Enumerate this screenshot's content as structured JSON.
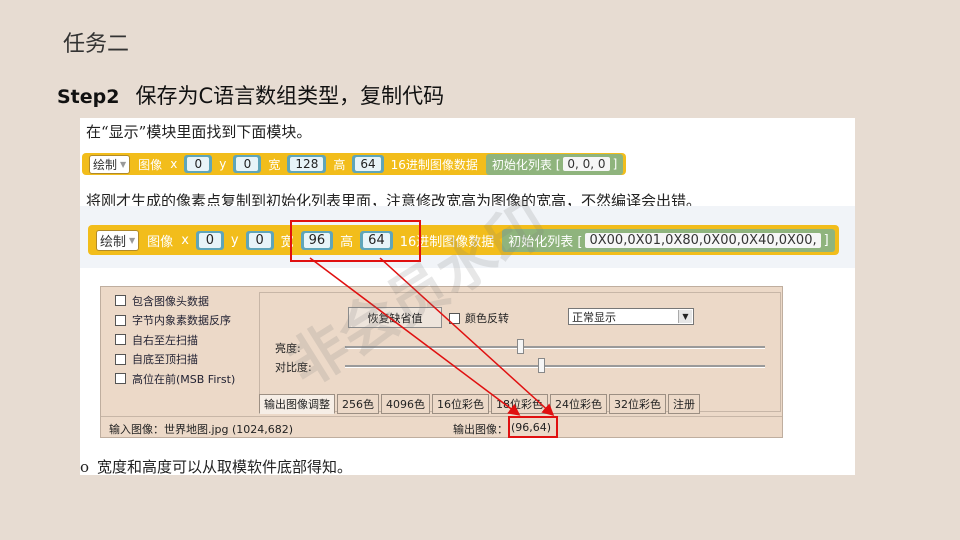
{
  "slide": {
    "title": "任务二",
    "step_num": "Step2",
    "step_text": "保存为C语言数组类型，复制代码"
  },
  "doc": {
    "line1": "在“显示”模块里面找到下面模块。",
    "line2": "将刚才生成的像素点复制到初始化列表里面，注意修改宽高为图像的宽高，不然编译会出错。",
    "line3": "宽度和高度可以从取模软件底部得知。",
    "line3_bullet": "o"
  },
  "block1": {
    "draw": "绘制",
    "image": "图像",
    "x_label": "x",
    "x": "0",
    "y_label": "y",
    "y": "0",
    "w_label": "宽",
    "w": "128",
    "h_label": "高",
    "h": "64",
    "hex_label": "16进制图像数据",
    "init_label": "初始化列表 [",
    "init_value": "0, 0, 0",
    "close": "]"
  },
  "block2": {
    "draw": "绘制",
    "image": "图像",
    "x_label": "x",
    "x": "0",
    "y_label": "y",
    "y": "0",
    "w_label": "宽",
    "w": "96",
    "h_label": "高",
    "h": "64",
    "hex_label": "16进制图像数据",
    "init_label": "初始化列表 [",
    "init_value": "0X00,0X01,0X80,0X00,0X40,0X00,",
    "close": "]"
  },
  "software": {
    "checks": [
      "包含图像头数据",
      "字节内象素数据反序",
      "自右至左扫描",
      "自底至顶扫描",
      "高位在前(MSB First)"
    ],
    "restore_btn": "恢复缺省值",
    "invert_label": "颜色反转",
    "display_mode": "正常显示",
    "brightness_label": "亮度:",
    "contrast_label": "对比度:",
    "brightness_value": 0.5,
    "contrast_value": 0.5,
    "tabs": [
      "输出图像调整",
      "256色",
      "4096色",
      "16位彩色",
      "18位彩色",
      "24位彩色",
      "32位彩色",
      "注册"
    ],
    "input_image": "输入图像：世界地图.jpg (1024,682)",
    "output_label": "输出图像：",
    "output_value": "(96,64)"
  },
  "watermark": "非会员水印",
  "colors": {
    "block": "#f2bd1b",
    "slot": "#5fa5b9",
    "list": "#8fb47d",
    "highlight": "#e01010"
  }
}
